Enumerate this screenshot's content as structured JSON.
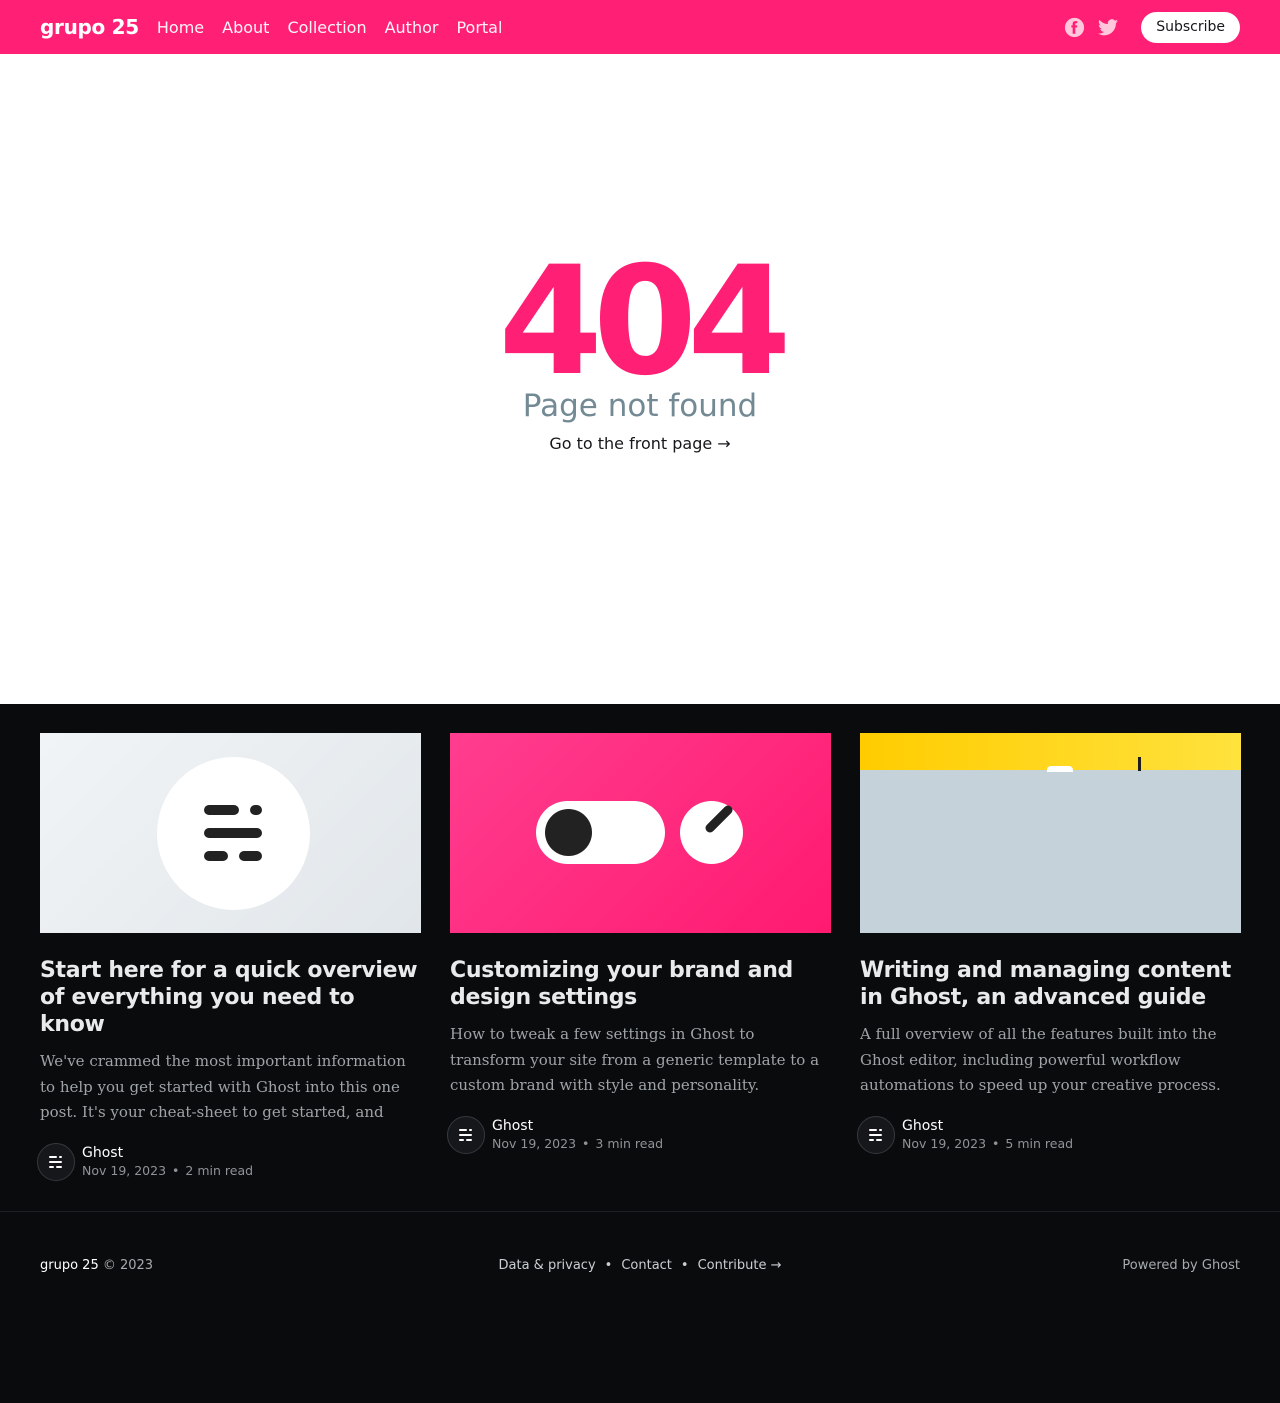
{
  "header": {
    "brand": "grupo 25",
    "nav": [
      "Home",
      "About",
      "Collection",
      "Author",
      "Portal"
    ],
    "social": [
      "facebook-icon",
      "twitter-icon"
    ],
    "subscribe_label": "Subscribe"
  },
  "error": {
    "code": "404",
    "message": "Page not found",
    "link": "Go to the front page →"
  },
  "posts": [
    {
      "title": "Start here for a quick overview of everything you need to know",
      "excerpt": "We've crammed the most important information to help you get started with Ghost into this one post. It's your cheat-sheet to get started, and your shortcut to...",
      "author": "Ghost",
      "date": "Nov 19, 2023",
      "read": "2 min read"
    },
    {
      "title": "Customizing your brand and design settings",
      "excerpt": "How to tweak a few settings in Ghost to transform your site from a generic template to a custom brand with style and personality.",
      "author": "Ghost",
      "date": "Nov 19, 2023",
      "read": "3 min read"
    },
    {
      "title": "Writing and managing content in Ghost, an advanced guide",
      "excerpt": "A full overview of all the features built into the Ghost editor, including powerful workflow automations to speed up your creative process.",
      "author": "Ghost",
      "date": "Nov 19, 2023",
      "read": "5 min read"
    }
  ],
  "footer": {
    "brand": "grupo 25",
    "copyright": "© 2023",
    "links": [
      "Data & privacy",
      "Contact",
      "Contribute →"
    ],
    "powered": "Powered by Ghost"
  },
  "colors": {
    "accent": "#ff1f75",
    "dark_bg": "#0a0b0c",
    "muted": "#738a94"
  }
}
